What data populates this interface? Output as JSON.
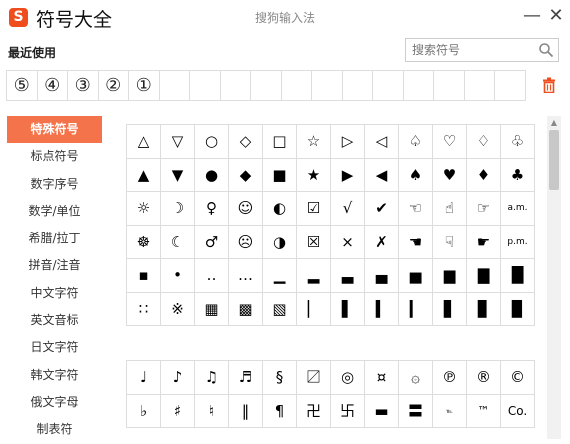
{
  "header": {
    "logo": "S",
    "title": "符号大全",
    "window_title": "搜狗输入法",
    "minimize": "—",
    "close": "✕"
  },
  "recent": {
    "label": "最近使用",
    "items": [
      "⑤",
      "④",
      "③",
      "②",
      "①",
      "",
      "",
      "",
      "",
      "",
      "",
      "",
      "",
      "",
      "",
      "",
      ""
    ]
  },
  "search": {
    "placeholder": "搜索符号"
  },
  "categories": [
    {
      "label": "特殊符号",
      "active": true
    },
    {
      "label": "标点符号"
    },
    {
      "label": "数字序号"
    },
    {
      "label": "数学/单位"
    },
    {
      "label": "希腊/拉丁"
    },
    {
      "label": "拼音/注音"
    },
    {
      "label": "中文字符"
    },
    {
      "label": "英文音标"
    },
    {
      "label": "日文字符"
    },
    {
      "label": "韩文字符"
    },
    {
      "label": "俄文字母"
    },
    {
      "label": "制表符"
    }
  ],
  "grid1": [
    "△",
    "▽",
    "○",
    "◇",
    "□",
    "☆",
    "▷",
    "◁",
    "♤",
    "♡",
    "♢",
    "♧",
    "▲",
    "▼",
    "●",
    "◆",
    "■",
    "★",
    "▶",
    "◀",
    "♠",
    "♥",
    "♦",
    "♣",
    "☼",
    "☽",
    "♀",
    "☺",
    "◐",
    "☑",
    "√",
    "✔",
    "☜",
    "☝",
    "☞",
    "a.m.",
    "☸",
    "☾",
    "♂",
    "☹",
    "◑",
    "☒",
    "×",
    "✗",
    "☚",
    "☟",
    "☛",
    "p.m.",
    "▪",
    "•",
    "‥",
    "…",
    "▁",
    "▂",
    "▃",
    "▄",
    "▅",
    "▆",
    "▇",
    "█",
    "∷",
    "※",
    "▦",
    "▩",
    "▧",
    "▏",
    "▌",
    "▍",
    "▎",
    "▋",
    "▊",
    "▉"
  ],
  "grid2": [
    "♩",
    "♪",
    "♫",
    "♬",
    "§",
    "〼",
    "◎",
    "¤",
    "۞",
    "℗",
    "®",
    "©",
    "♭",
    "♯",
    "♮",
    "‖",
    "¶",
    "卍",
    "卐",
    "▬",
    "〓",
    "℡",
    "™",
    "Co."
  ],
  "colors": {
    "accent": "#f5734a",
    "logo": "#ef4d1d"
  }
}
